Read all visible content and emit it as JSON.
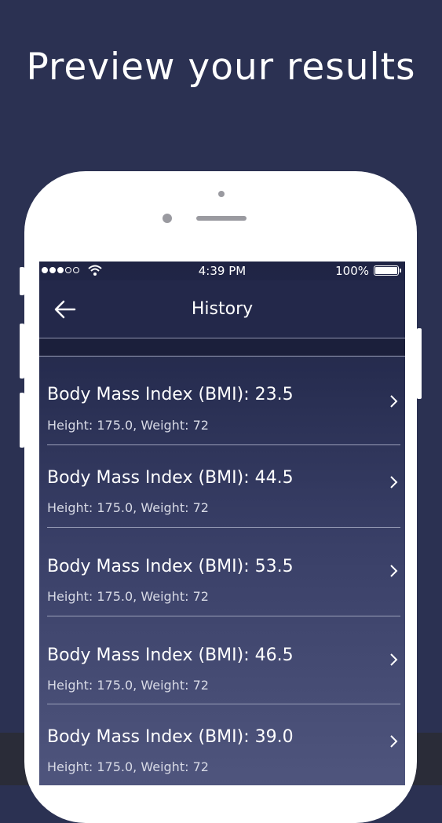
{
  "promo": {
    "headline": "Preview your results"
  },
  "status_bar": {
    "time": "4:39 PM",
    "battery": "100%"
  },
  "nav": {
    "title": "History"
  },
  "history": [
    {
      "title": "Body Mass Index (BMI): 23.5",
      "details": "Height: 175.0, Weight: 72"
    },
    {
      "title": "Body Mass Index (BMI): 44.5",
      "details": "Height: 175.0, Weight: 72"
    },
    {
      "title": "Body Mass Index (BMI): 53.5",
      "details": "Height: 175.0, Weight: 72"
    },
    {
      "title": "Body Mass Index (BMI): 46.5",
      "details": "Height: 175.0, Weight: 72"
    },
    {
      "title": "Body Mass Index (BMI): 39.0",
      "details": "Height: 175.0, Weight: 72"
    }
  ],
  "colors": {
    "background": "#2b3152",
    "nav_background": "#23284a",
    "text": "#ffffff"
  },
  "icons": {
    "back": "arrow-left-icon",
    "row": "chevron-right-icon",
    "wifi": "wifi-icon",
    "battery": "battery-icon"
  }
}
